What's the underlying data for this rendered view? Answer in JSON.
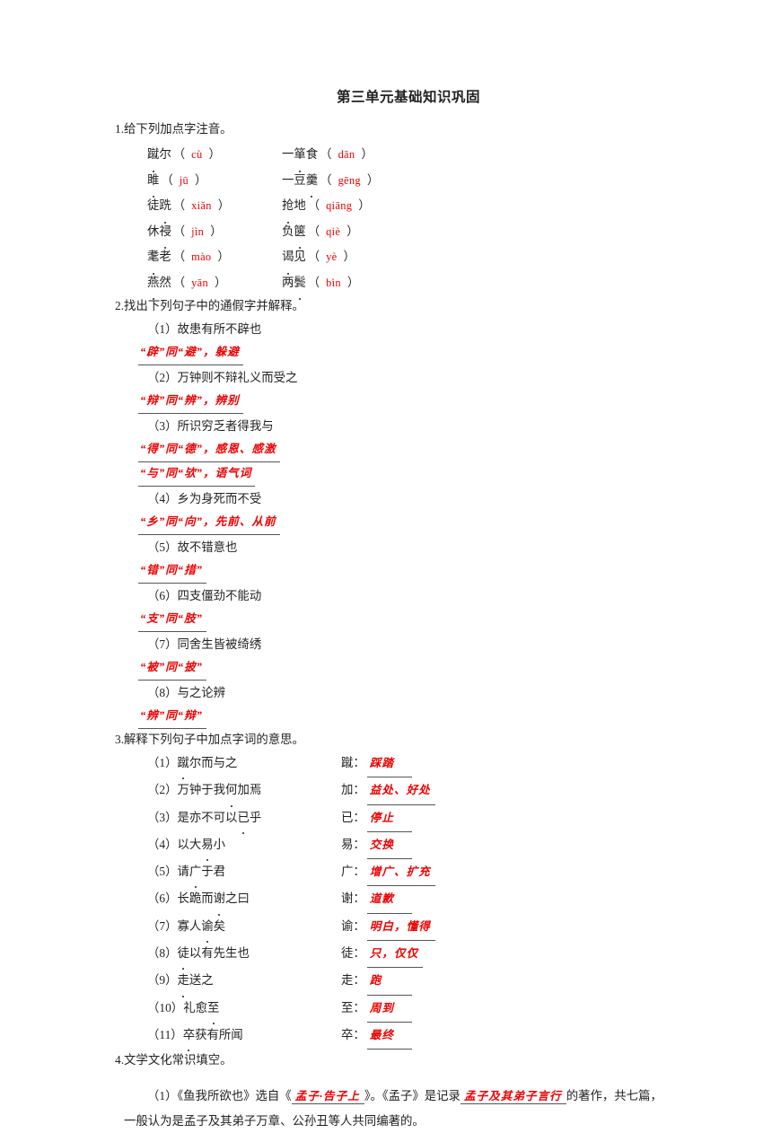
{
  "title": "第三单元基础知识巩固",
  "sections": {
    "s1": {
      "heading": "1.给下列加点字注音。",
      "rows": [
        {
          "left": {
            "pre": "蹴",
            "dot": "",
            "post": "尔",
            "dotIndex": 0,
            "word": "蹴尔",
            "pinyin": "cù"
          },
          "right": {
            "word": "一箪食",
            "dotIndex": 1,
            "pinyin": "dān"
          }
        },
        {
          "left": {
            "word": "雎",
            "dotIndex": 0,
            "pinyin": "jū"
          },
          "right": {
            "word": "一豆羹",
            "dotIndex": 2,
            "pinyin": "gēng"
          }
        },
        {
          "left": {
            "word": "徒跣",
            "dotIndex": 1,
            "pinyin": "xiǎn"
          },
          "right": {
            "word": "抢地",
            "dotIndex": 0,
            "pinyin": "qiāng"
          }
        },
        {
          "left": {
            "word": "休祲",
            "dotIndex": 1,
            "pinyin": "jìn"
          },
          "right": {
            "word": "负箧",
            "dotIndex": 1,
            "pinyin": "qiè"
          }
        },
        {
          "left": {
            "word": "耄老",
            "dotIndex": 0,
            "pinyin": "mào"
          },
          "right": {
            "word": "谒见",
            "dotIndex": 0,
            "pinyin": "yè"
          }
        },
        {
          "left": {
            "word": "燕然",
            "dotIndex": 0,
            "pinyin": "yān"
          },
          "right": {
            "word": "两鬓",
            "dotIndex": 1,
            "pinyin": "bìn"
          }
        }
      ]
    },
    "s2": {
      "heading": "2.找出下列句子中的通假字并解释。",
      "items": [
        {
          "q": "（1）故患有所不辟也",
          "answers": [
            "“辟”同“避”，躲避"
          ]
        },
        {
          "q": "（2）万钟则不辩礼义而受之",
          "answers": [
            "“辩”同“辨”，辨别"
          ]
        },
        {
          "q": "（3）所识穷乏者得我与",
          "answers": [
            "“得”同“德”，感恩、感激",
            "“与”同“欤”，语气词"
          ]
        },
        {
          "q": "（4）乡为身死而不受",
          "answers": [
            "“乡”同“向”，先前、从前"
          ]
        },
        {
          "q": "（5）故不错意也",
          "answers": [
            "“错”同“措”"
          ]
        },
        {
          "q": "（6）四支僵劲不能动",
          "answers": [
            "“支”同“肢”"
          ]
        },
        {
          "q": "（7）同舍生皆被绮绣",
          "answers": [
            "“被”同“披”"
          ]
        },
        {
          "q": "（8）与之论辨",
          "answers": [
            "“辨”同“辩”"
          ]
        }
      ]
    },
    "s3": {
      "heading": "3.解释下列句子中加点字词的意思。",
      "rows": [
        {
          "q": "（1）蹴尔而与之",
          "dotIndex": 3,
          "key": "蹴：",
          "val": "踩踏"
        },
        {
          "q": "（2）万钟于我何加焉",
          "dotIndex": 7,
          "key": "加：",
          "val": "益处、好处"
        },
        {
          "q": "（3）是亦不可以已乎",
          "dotIndex": 8,
          "key": "已：",
          "val": "停止"
        },
        {
          "q": "（4）以大易小",
          "dotIndex": 5,
          "key": "易：",
          "val": "交换"
        },
        {
          "q": "（5）请广于君",
          "dotIndex": 4,
          "key": "广：",
          "val": "增广、扩充"
        },
        {
          "q": "（6）长跪而谢之曰",
          "dotIndex": 6,
          "key": "谢：",
          "val": "道歉"
        },
        {
          "q": "（7）寡人谕矣",
          "dotIndex": 5,
          "key": "谕：",
          "val": "明白，懂得"
        },
        {
          "q": "（8）徒以有先生也",
          "dotIndex": 3,
          "key": "徒：",
          "val": "只，仅仅"
        },
        {
          "q": "（9）走送之",
          "dotIndex": 3,
          "key": "走：",
          "val": "跑"
        },
        {
          "q": "（10）礼愈至",
          "dotIndex": 6,
          "key": "至：",
          "val": "周到"
        },
        {
          "q": "（11）卒获有所闻",
          "dotIndex": 4,
          "key": "卒：",
          "val": "最终"
        }
      ]
    },
    "s4": {
      "heading": "4.文学文化常识填空。",
      "p1_a": "（1）《鱼我所欲也》选自《",
      "p1_blank1": "孟子·告子上",
      "p1_b": "》。《孟子》是记录",
      "p1_blank2": "孟子及其弟子言行",
      "p1_c": "的著作，共七篇，一般认为是孟子及其弟子万章、公孙丑等人共同编著的。"
    }
  },
  "colors": {
    "answer_red": "#ee0000",
    "text_black": "#231f20",
    "underline_gray": "#555555"
  }
}
